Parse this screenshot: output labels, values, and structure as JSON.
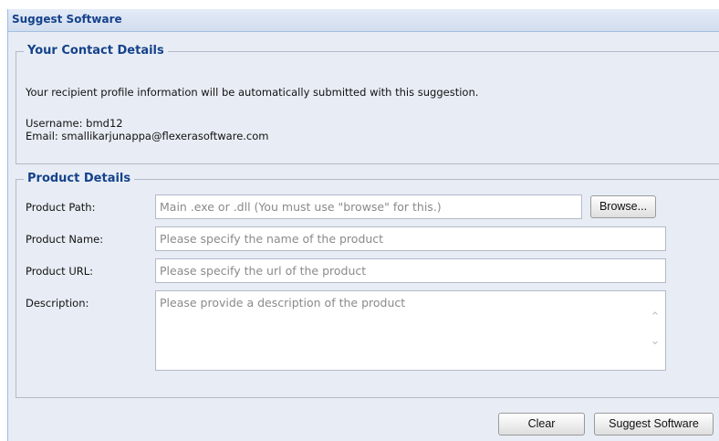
{
  "panel": {
    "title": "Suggest Software"
  },
  "contact": {
    "legend": "Your Contact Details",
    "note": "Your recipient profile information will be automatically submitted with this suggestion.",
    "username": "Username: bmd12",
    "email": "Email: smallikarjunappa@flexerasoftware.com"
  },
  "product": {
    "legend": "Product Details",
    "path_label": "Product Path:",
    "path_placeholder": "Main .exe or .dll  (You must use \"browse\" for this.)",
    "browse_label": "Browse...",
    "name_label": "Product Name:",
    "name_placeholder": "Please specify the name of the product",
    "url_label": "Product URL:",
    "url_placeholder": "Please specify the url of the product",
    "description_label": "Description:",
    "description_placeholder": "Please provide a description of the product"
  },
  "actions": {
    "clear_label": "Clear",
    "suggest_label": "Suggest Software"
  },
  "icons": {
    "scroll_up": "chevron-up-icon",
    "scroll_down": "chevron-down-icon"
  }
}
